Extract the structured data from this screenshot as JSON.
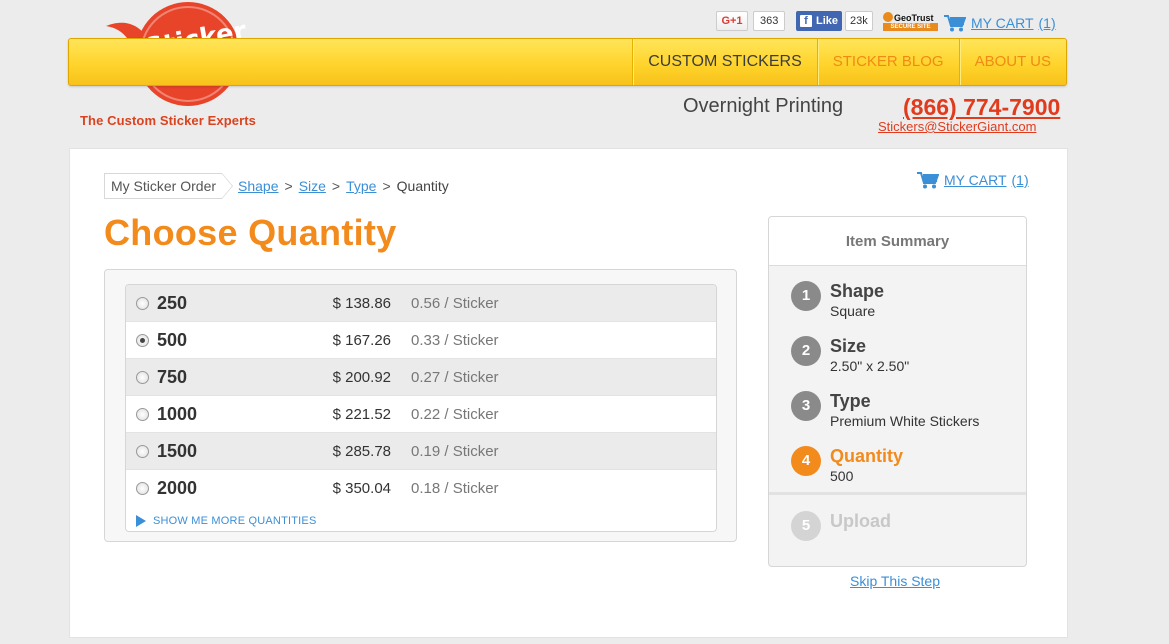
{
  "header": {
    "tagline": "The Custom Sticker Experts",
    "logo_text": "Sticker Giant",
    "gplus_label": "G+1",
    "gplus_count": "363",
    "fb_label": "Like",
    "fb_count": "23k",
    "geotrust_label": "GeoTrust",
    "geotrust_sub": "SECURE SITE",
    "cart_label": "MY CART",
    "cart_count": "(1)",
    "nav": [
      "CUSTOM STICKERS",
      "STICKER BLOG",
      "ABOUT US"
    ],
    "overnight": "Overnight Printing",
    "phone": "(866) 774-7900",
    "email": "Stickers@StickerGiant.com"
  },
  "breadcrumb": {
    "root": "My Sticker Order",
    "links": [
      "Shape",
      "Size",
      "Type"
    ],
    "separator": ">",
    "current": "Quantity"
  },
  "page_title": "Choose Quantity",
  "quantities": {
    "rows": [
      {
        "qty": "250",
        "price": "$ 138.86",
        "per": "0.56 / Sticker"
      },
      {
        "qty": "500",
        "price": "$ 167.26",
        "per": "0.33 / Sticker"
      },
      {
        "qty": "750",
        "price": "$ 200.92",
        "per": "0.27 / Sticker"
      },
      {
        "qty": "1000",
        "price": "$ 221.52",
        "per": "0.22 / Sticker"
      },
      {
        "qty": "1500",
        "price": "$ 285.78",
        "per": "0.19 / Sticker"
      },
      {
        "qty": "2000",
        "price": "$ 350.04",
        "per": "0.18 / Sticker"
      }
    ],
    "selected": "500",
    "more_label": "SHOW ME MORE QUANTITIES"
  },
  "summary": {
    "title": "Item Summary",
    "steps": [
      {
        "num": "1",
        "label": "Shape",
        "value": "Square"
      },
      {
        "num": "2",
        "label": "Size",
        "value": "2.50\" x 2.50\""
      },
      {
        "num": "3",
        "label": "Type",
        "value": "Premium White Stickers"
      },
      {
        "num": "4",
        "label": "Quantity",
        "value": "500"
      },
      {
        "num": "5",
        "label": "Upload",
        "value": ""
      }
    ]
  },
  "skip_label": "Skip This Step",
  "colors": {
    "accent_orange": "#f28a1c",
    "brand_red": "#e13b1e",
    "link_blue": "#3b8fd6",
    "nav_yellow": "#ffd42c"
  }
}
